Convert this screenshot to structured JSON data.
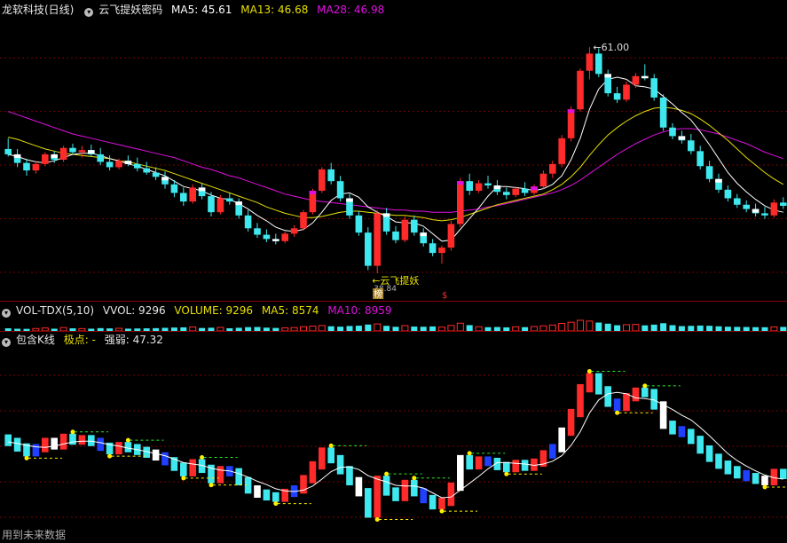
{
  "main_header": {
    "title": "龙软科技(日线)",
    "indicator": "云飞提妖密码",
    "ma5_label": "MA5: 45.61",
    "ma13_label": "MA13: 46.68",
    "ma28_label": "MA28: 46.98"
  },
  "vol_header": {
    "name": "VOL-TDX(5,10)",
    "vvol": "VVOL: 9296",
    "volume": "VOLUME: 9296",
    "ma5": "MA5: 8574",
    "ma10": "MA10: 8959"
  },
  "sub_header": {
    "name": "包含K线",
    "jidian": "极点: -",
    "qiangruo": "强弱: 47.32"
  },
  "annotations": {
    "high_price": "61.00",
    "low_signal": "云飞提妖",
    "low_value": "38.84",
    "badge": "榜",
    "dollar": "$"
  },
  "footer": {
    "text": "用到未来数据"
  },
  "colors": {
    "up": "#ff2a2a",
    "down": "#3ee8ee",
    "ma5": "#ffffff",
    "ma13": "#e8e000",
    "ma28": "#e010e0",
    "bg": "#000000",
    "grid": "#7a0000"
  },
  "chart_data": [
    {
      "type": "candlestick",
      "title": "龙软科技(日线)",
      "series_lines": [
        "MA5",
        "MA13",
        "MA28"
      ],
      "annotations": [
        {
          "label": "61.00",
          "kind": "high"
        },
        {
          "label": "云飞提妖",
          "kind": "signal"
        }
      ],
      "ylim": [
        38,
        63
      ],
      "candles": [
        [
          51.5,
          52.5,
          50.8,
          51.0
        ],
        [
          51.0,
          51.5,
          49.8,
          50.2
        ],
        [
          50.2,
          50.6,
          49.0,
          49.5
        ],
        [
          49.5,
          50.4,
          49.2,
          50.1
        ],
        [
          50.1,
          51.2,
          49.9,
          51.0
        ],
        [
          51.0,
          51.3,
          50.2,
          50.5
        ],
        [
          50.5,
          51.8,
          50.3,
          51.6
        ],
        [
          51.6,
          52.0,
          51.0,
          51.2
        ],
        [
          51.2,
          51.8,
          50.7,
          51.4
        ],
        [
          51.4,
          51.9,
          50.8,
          51.0
        ],
        [
          51.0,
          51.6,
          50.0,
          50.3
        ],
        [
          50.3,
          50.9,
          49.5,
          49.8
        ],
        [
          49.8,
          50.6,
          49.6,
          50.4
        ],
        [
          50.4,
          50.9,
          49.9,
          50.1
        ],
        [
          50.1,
          50.7,
          49.4,
          49.7
        ],
        [
          49.7,
          50.3,
          49.1,
          49.3
        ],
        [
          49.3,
          49.8,
          48.6,
          48.9
        ],
        [
          48.9,
          49.4,
          47.8,
          48.2
        ],
        [
          48.2,
          48.6,
          47.0,
          47.4
        ],
        [
          47.4,
          47.9,
          46.2,
          46.6
        ],
        [
          46.6,
          48.2,
          46.4,
          47.9
        ],
        [
          47.9,
          48.3,
          46.8,
          47.1
        ],
        [
          47.1,
          47.5,
          45.2,
          45.6
        ],
        [
          45.6,
          47.2,
          45.4,
          46.9
        ],
        [
          46.9,
          47.4,
          46.3,
          46.6
        ],
        [
          46.6,
          46.9,
          45.0,
          45.3
        ],
        [
          45.3,
          45.8,
          43.8,
          44.1
        ],
        [
          44.1,
          44.6,
          43.2,
          43.5
        ],
        [
          43.5,
          44.0,
          42.8,
          43.1
        ],
        [
          43.1,
          43.6,
          42.6,
          42.9
        ],
        [
          42.9,
          43.8,
          42.7,
          43.6
        ],
        [
          43.6,
          44.4,
          43.3,
          44.1
        ],
        [
          44.1,
          45.8,
          43.9,
          45.6
        ],
        [
          45.6,
          47.8,
          45.4,
          47.6
        ],
        [
          47.6,
          49.8,
          47.4,
          49.6
        ],
        [
          49.6,
          50.2,
          48.2,
          48.5
        ],
        [
          48.5,
          49.0,
          46.6,
          46.9
        ],
        [
          46.9,
          47.3,
          45.0,
          45.3
        ],
        [
          45.3,
          45.7,
          43.4,
          43.7
        ],
        [
          43.7,
          44.2,
          40.2,
          40.6
        ],
        [
          40.6,
          45.8,
          39.9,
          45.5
        ],
        [
          45.5,
          46.0,
          43.5,
          43.8
        ],
        [
          43.8,
          44.3,
          42.7,
          43.0
        ],
        [
          43.0,
          45.2,
          42.8,
          44.9
        ],
        [
          44.9,
          45.3,
          43.4,
          43.7
        ],
        [
          43.7,
          44.1,
          42.4,
          42.7
        ],
        [
          42.7,
          43.1,
          41.5,
          41.8
        ],
        [
          41.8,
          42.5,
          40.8,
          42.3
        ],
        [
          42.3,
          44.8,
          42.0,
          44.5
        ],
        [
          44.5,
          48.8,
          44.2,
          48.5
        ],
        [
          48.5,
          49.2,
          47.2,
          47.6
        ],
        [
          47.6,
          48.6,
          47.4,
          48.3
        ],
        [
          48.3,
          49.0,
          47.8,
          48.1
        ],
        [
          48.1,
          48.6,
          47.2,
          47.5
        ],
        [
          47.5,
          47.9,
          46.8,
          47.2
        ],
        [
          47.2,
          48.0,
          47.0,
          47.8
        ],
        [
          47.8,
          48.4,
          47.1,
          47.4
        ],
        [
          47.4,
          48.2,
          47.2,
          48.0
        ],
        [
          48.0,
          49.5,
          47.8,
          49.2
        ],
        [
          49.2,
          50.4,
          48.8,
          50.1
        ],
        [
          50.1,
          52.8,
          49.8,
          52.5
        ],
        [
          52.5,
          55.5,
          52.2,
          55.2
        ],
        [
          55.2,
          59.0,
          55.0,
          58.8
        ],
        [
          58.8,
          61.0,
          58.0,
          60.4
        ],
        [
          60.4,
          60.9,
          58.2,
          58.5
        ],
        [
          58.5,
          58.9,
          56.4,
          56.7
        ],
        [
          56.7,
          57.3,
          55.8,
          56.1
        ],
        [
          56.1,
          57.8,
          55.9,
          57.5
        ],
        [
          57.5,
          58.6,
          57.2,
          58.3
        ],
        [
          58.3,
          59.4,
          57.9,
          58.1
        ],
        [
          58.1,
          58.5,
          56.0,
          56.3
        ],
        [
          56.3,
          56.6,
          53.2,
          53.5
        ],
        [
          53.5,
          53.9,
          52.4,
          52.7
        ],
        [
          52.7,
          53.2,
          52.0,
          52.3
        ],
        [
          52.3,
          52.9,
          51.0,
          51.3
        ],
        [
          51.3,
          51.8,
          49.6,
          49.9
        ],
        [
          49.9,
          50.4,
          48.4,
          48.7
        ],
        [
          48.7,
          49.2,
          47.4,
          47.7
        ],
        [
          47.7,
          48.1,
          46.6,
          46.9
        ],
        [
          46.9,
          47.3,
          46.0,
          46.3
        ],
        [
          46.3,
          46.7,
          45.6,
          45.9
        ],
        [
          45.9,
          46.4,
          45.2,
          45.5
        ],
        [
          45.5,
          46.1,
          45.0,
          45.3
        ],
        [
          45.3,
          46.8,
          45.1,
          46.5
        ],
        [
          46.5,
          47.0,
          45.9,
          46.2
        ]
      ],
      "ma5": [
        51.0,
        50.8,
        50.5,
        50.3,
        50.2,
        50.4,
        50.7,
        51.0,
        51.1,
        51.1,
        50.9,
        50.6,
        50.4,
        50.1,
        49.9,
        49.6,
        49.3,
        49.0,
        48.5,
        48.0,
        47.8,
        47.6,
        47.2,
        46.9,
        46.8,
        46.4,
        45.9,
        45.3,
        44.8,
        44.2,
        43.9,
        43.8,
        44.0,
        44.6,
        45.6,
        46.7,
        47.3,
        47.4,
        47.0,
        46.1,
        45.6,
        45.2,
        44.7,
        44.6,
        44.6,
        44.3,
        43.6,
        42.9,
        43.0,
        44.0,
        45.0,
        46.0,
        47.1,
        48.0,
        48.0,
        47.9,
        47.8,
        47.6,
        47.8,
        48.2,
        49.0,
        50.5,
        52.5,
        55.2,
        57.1,
        58.0,
        58.2,
        58.0,
        57.4,
        57.3,
        57.1,
        56.4,
        55.7,
        54.9,
        54.2,
        53.1,
        51.9,
        50.6,
        49.3,
        48.3,
        47.5,
        46.8,
        46.2,
        45.8,
        45.6
      ],
      "ma13": [
        52.6,
        52.4,
        52.1,
        51.8,
        51.5,
        51.3,
        51.1,
        51.0,
        50.9,
        50.8,
        50.7,
        50.6,
        50.4,
        50.3,
        50.1,
        49.9,
        49.7,
        49.5,
        49.2,
        48.9,
        48.6,
        48.3,
        48.0,
        47.7,
        47.4,
        47.1,
        46.8,
        46.5,
        46.1,
        45.8,
        45.5,
        45.3,
        45.1,
        45.1,
        45.2,
        45.4,
        45.6,
        45.7,
        45.7,
        45.6,
        45.5,
        45.4,
        45.3,
        45.3,
        45.2,
        45.1,
        44.9,
        44.8,
        44.9,
        45.1,
        45.4,
        45.7,
        46.0,
        46.3,
        46.5,
        46.7,
        46.9,
        47.1,
        47.3,
        47.7,
        48.2,
        48.9,
        49.8,
        50.9,
        51.9,
        52.8,
        53.5,
        54.1,
        54.6,
        55.0,
        55.3,
        55.4,
        55.3,
        55.1,
        54.8,
        54.3,
        53.7,
        53.0,
        52.3,
        51.5,
        50.7,
        50.0,
        49.3,
        48.7,
        48.2
      ],
      "ma28": [
        55.0,
        54.7,
        54.4,
        54.1,
        53.8,
        53.5,
        53.2,
        52.9,
        52.7,
        52.5,
        52.3,
        52.1,
        51.9,
        51.7,
        51.5,
        51.3,
        51.1,
        50.9,
        50.7,
        50.4,
        50.1,
        49.8,
        49.6,
        49.3,
        49.0,
        48.8,
        48.5,
        48.2,
        47.9,
        47.6,
        47.3,
        47.1,
        46.9,
        46.7,
        46.6,
        46.5,
        46.4,
        46.3,
        46.2,
        46.1,
        46.0,
        45.9,
        45.8,
        45.8,
        45.7,
        45.7,
        45.6,
        45.6,
        45.6,
        45.7,
        45.8,
        45.9,
        46.1,
        46.2,
        46.4,
        46.6,
        46.8,
        47.0,
        47.2,
        47.4,
        47.7,
        48.1,
        48.6,
        49.2,
        49.8,
        50.4,
        51.0,
        51.5,
        52.0,
        52.4,
        52.8,
        53.1,
        53.3,
        53.4,
        53.4,
        53.3,
        53.1,
        52.9,
        52.6,
        52.3,
        52.0,
        51.6,
        51.2,
        50.9,
        50.6
      ]
    },
    {
      "type": "bar",
      "title": "VOL-TDX(5,10)",
      "series": [
        {
          "name": "VOLUME",
          "values": [
            6200,
            5100,
            4800,
            5600,
            6900,
            5200,
            7800,
            6100,
            5400,
            5200,
            6500,
            5900,
            6100,
            5300,
            5700,
            6000,
            6400,
            7200,
            7900,
            8300,
            9100,
            6800,
            7400,
            8200,
            6200,
            7300,
            8800,
            9100,
            7600,
            6900,
            7100,
            7800,
            9800,
            11200,
            12500,
            10800,
            9900,
            11400,
            12100,
            14800,
            16200,
            11800,
            9600,
            12300,
            10100,
            9700,
            10400,
            8900,
            12700,
            17900,
            13400,
            9800,
            8700,
            9100,
            8300,
            9600,
            8800,
            10200,
            11900,
            13700,
            17400,
            20100,
            24600,
            22800,
            19400,
            16800,
            13200,
            14400,
            15100,
            12900,
            14600,
            17900,
            13300,
            11200,
            11800,
            12500,
            11900,
            10700,
            9800,
            9400,
            9100,
            8800,
            8600,
            9300,
            9296
          ]
        }
      ]
    },
    {
      "type": "bar",
      "title": "包含K线",
      "series": [
        {
          "name": "强弱",
          "values": [
            47.32
          ]
        }
      ]
    }
  ]
}
